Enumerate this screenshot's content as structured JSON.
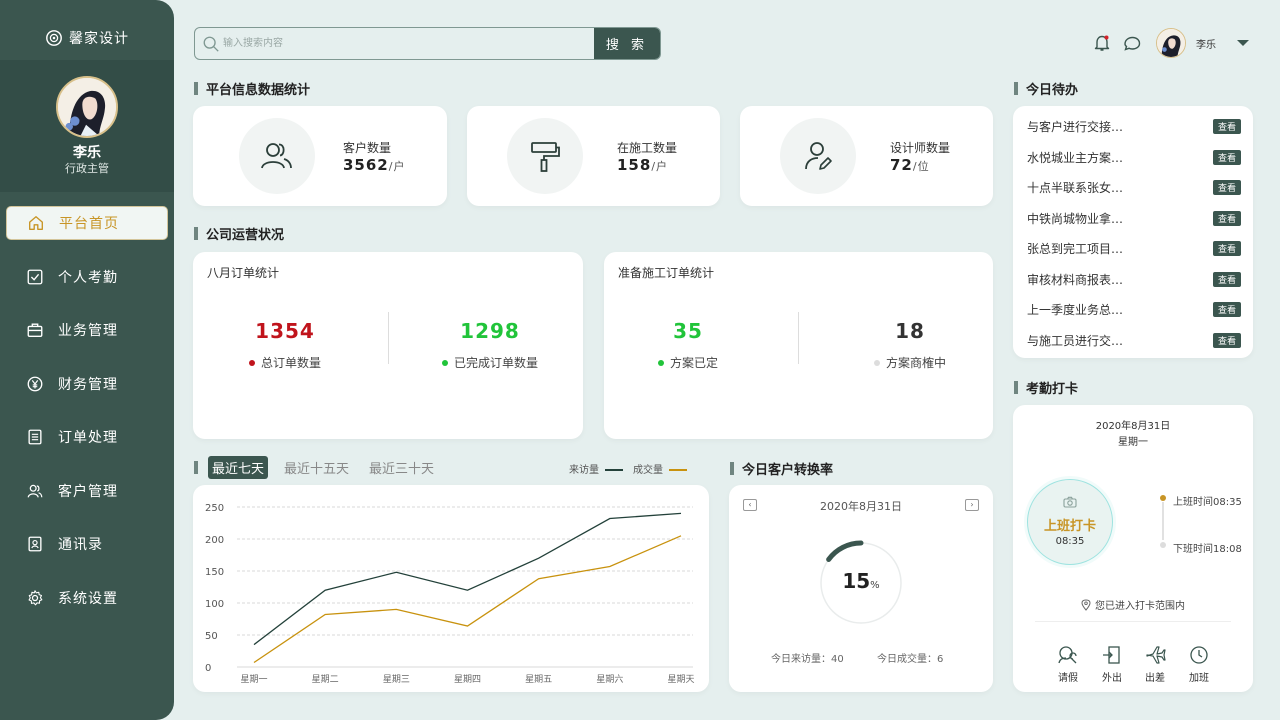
{
  "brand": {
    "name": "馨家设计"
  },
  "profile": {
    "name": "李乐",
    "role": "行政主管"
  },
  "nav": [
    {
      "label": "平台首页",
      "icon": "home-icon",
      "active": true
    },
    {
      "label": "个人考勤",
      "icon": "check-square-icon",
      "active": false
    },
    {
      "label": "业务管理",
      "icon": "briefcase-icon",
      "active": false
    },
    {
      "label": "财务管理",
      "icon": "yen-icon",
      "active": false
    },
    {
      "label": "订单处理",
      "icon": "order-list-icon",
      "active": false
    },
    {
      "label": "客户管理",
      "icon": "customers-icon",
      "active": false
    },
    {
      "label": "通讯录",
      "icon": "contacts-icon",
      "active": false
    },
    {
      "label": "系统设置",
      "icon": "gear-icon",
      "active": false
    }
  ],
  "search": {
    "placeholder": "输入搜索内容",
    "button": "搜 索"
  },
  "topbar": {
    "user_name": "李乐"
  },
  "sections": {
    "platform": "平台信息数据统计",
    "operations": "公司运营状况",
    "todo": "今日待办",
    "attendance": "考勤打卡",
    "conversion": "今日客户转换率"
  },
  "stats": [
    {
      "label": "客户数量",
      "value": "3562",
      "unit": "/户"
    },
    {
      "label": "在施工数量",
      "value": "158",
      "unit": "/户"
    },
    {
      "label": "设计师数量",
      "value": "72",
      "unit": "/位"
    }
  ],
  "orders_august": {
    "title": "八月订单统计",
    "total": {
      "value": "1354",
      "label": "总订单数量",
      "color": "#c0141c"
    },
    "done": {
      "value": "1298",
      "label": "已完成订单数量",
      "color": "#21c43a"
    }
  },
  "orders_pending": {
    "title": "准备施工订单统计",
    "decided": {
      "value": "35",
      "label": "方案已定",
      "color": "#21c43a"
    },
    "discussing": {
      "value": "18",
      "label": "方案商榷中",
      "color": "#333333"
    }
  },
  "tabs": [
    {
      "label": "最近七天",
      "active": true
    },
    {
      "label": "最近十五天",
      "active": false
    },
    {
      "label": "最近三十天",
      "active": false
    }
  ],
  "chart_data": {
    "type": "line",
    "categories": [
      "星期一",
      "星期二",
      "星期三",
      "星期四",
      "星期五",
      "星期六",
      "星期天"
    ],
    "series": [
      {
        "name": "来访量",
        "color": "#23413a",
        "values": [
          35,
          120,
          148,
          120,
          170,
          232,
          240
        ]
      },
      {
        "name": "成交量",
        "color": "#c8920e",
        "values": [
          7,
          82,
          90,
          64,
          138,
          157,
          205
        ]
      }
    ],
    "yticks": [
      0,
      50,
      100,
      150,
      200,
      250
    ],
    "ylim": [
      0,
      250
    ],
    "grid": true,
    "legend": "top-right"
  },
  "todos": [
    {
      "text": "与客户进行交接…",
      "button": "查看"
    },
    {
      "text": "水悦城业主方案…",
      "button": "查看"
    },
    {
      "text": "十点半联系张女…",
      "button": "查看"
    },
    {
      "text": "中铁尚城物业拿…",
      "button": "查看"
    },
    {
      "text": "张总到完工项目…",
      "button": "查看"
    },
    {
      "text": "审核材料商报表…",
      "button": "查看"
    },
    {
      "text": "上一季度业务总…",
      "button": "查看"
    },
    {
      "text": "与施工员进行交…",
      "button": "查看"
    }
  ],
  "conversion": {
    "date": "2020年8月31日",
    "percent": "15",
    "percent_unit": "%",
    "rate": 0.15,
    "visits": "今日来访量：40",
    "deals": "今日成交量：6"
  },
  "attendance": {
    "date": "2020年8月31日",
    "weekday": "星期一",
    "clock_label": "上班打卡",
    "clock_time": "08:35",
    "on_duty": "上班时间08:35",
    "off_duty": "下班时间18:08",
    "location": "您已进入打卡范围内",
    "actions": [
      "请假",
      "外出",
      "出差",
      "加班"
    ]
  },
  "colors": {
    "primary": "#3b564f",
    "accent": "#c89526",
    "background": "#e5efee"
  }
}
